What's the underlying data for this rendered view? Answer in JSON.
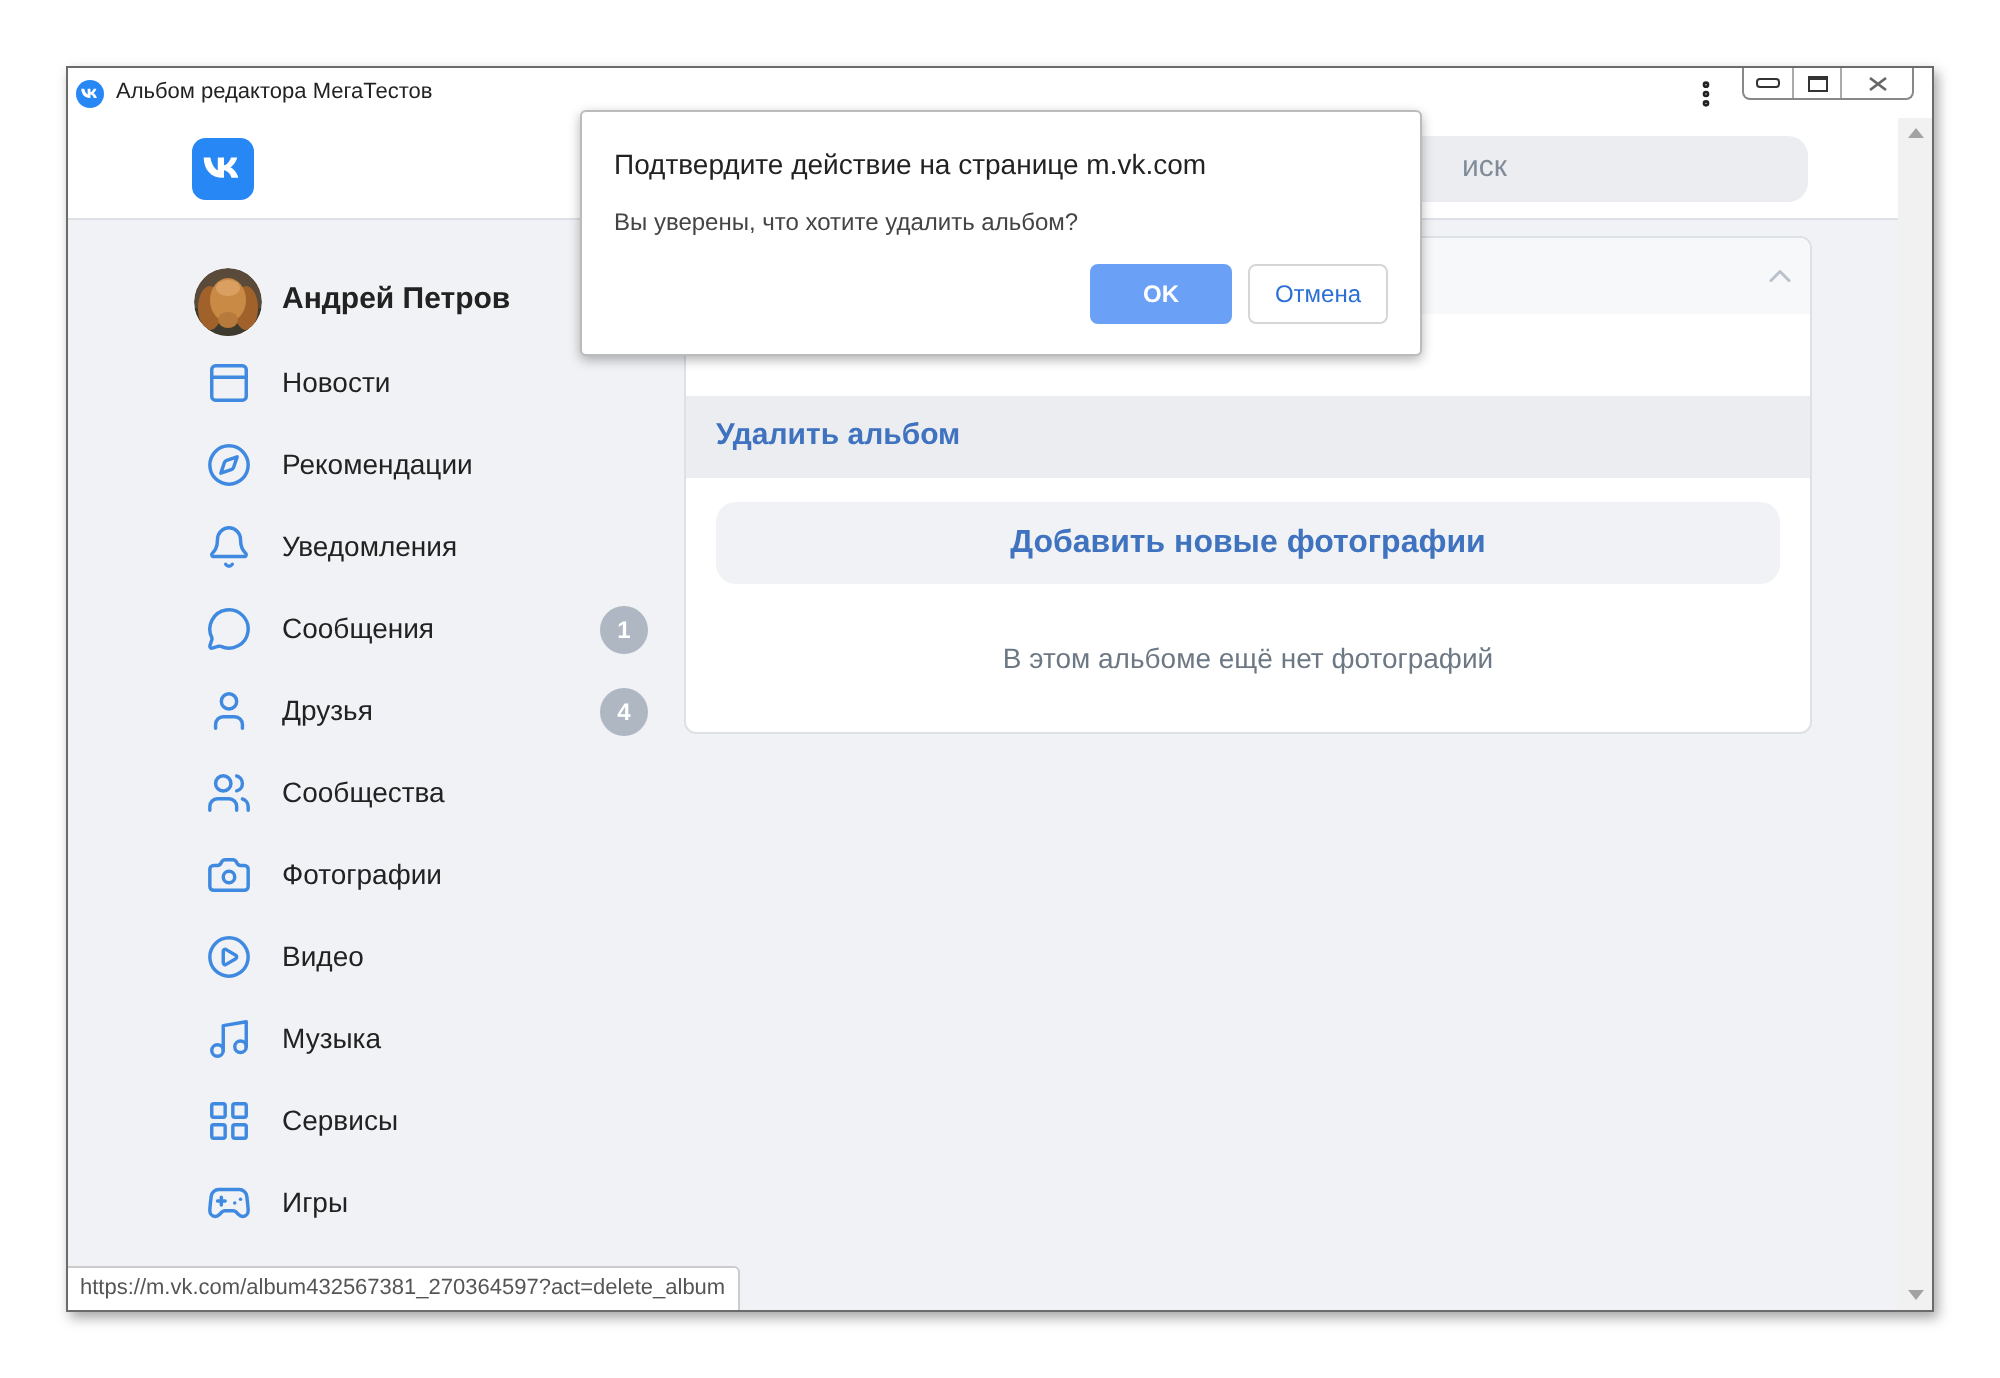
{
  "window": {
    "title": "Альбом редактора МегаТестов"
  },
  "header": {
    "search": {
      "placeholder": "иск"
    }
  },
  "sidebar": {
    "profile": {
      "name": "Андрей Петров"
    },
    "items": [
      {
        "label": "Новости"
      },
      {
        "label": "Рекомендации"
      },
      {
        "label": "Уведомления"
      },
      {
        "label": "Сообщения",
        "badge": "1"
      },
      {
        "label": "Друзья",
        "badge": "4"
      },
      {
        "label": "Сообщества"
      },
      {
        "label": "Фотографии"
      },
      {
        "label": "Видео"
      },
      {
        "label": "Музыка"
      },
      {
        "label": "Сервисы"
      },
      {
        "label": "Игры"
      }
    ]
  },
  "album_menu": {
    "items": [
      {
        "selected": false
      },
      {
        "label": "Удалить альбом",
        "selected": true
      }
    ],
    "add_button": "Добавить новые фотографии",
    "empty_text": "В этом альбоме ещё нет фотографий"
  },
  "dialog": {
    "title": "Подтвердите действие на странице m.vk.com",
    "message": "Вы уверены, что хотите удалить альбом?",
    "buttons": [
      {
        "label": "OK",
        "kind": "primary"
      },
      {
        "label": "Отмена",
        "kind": "secondary"
      }
    ]
  },
  "status_url": "https://m.vk.com/album432567381_270364597?act=delete_album"
}
